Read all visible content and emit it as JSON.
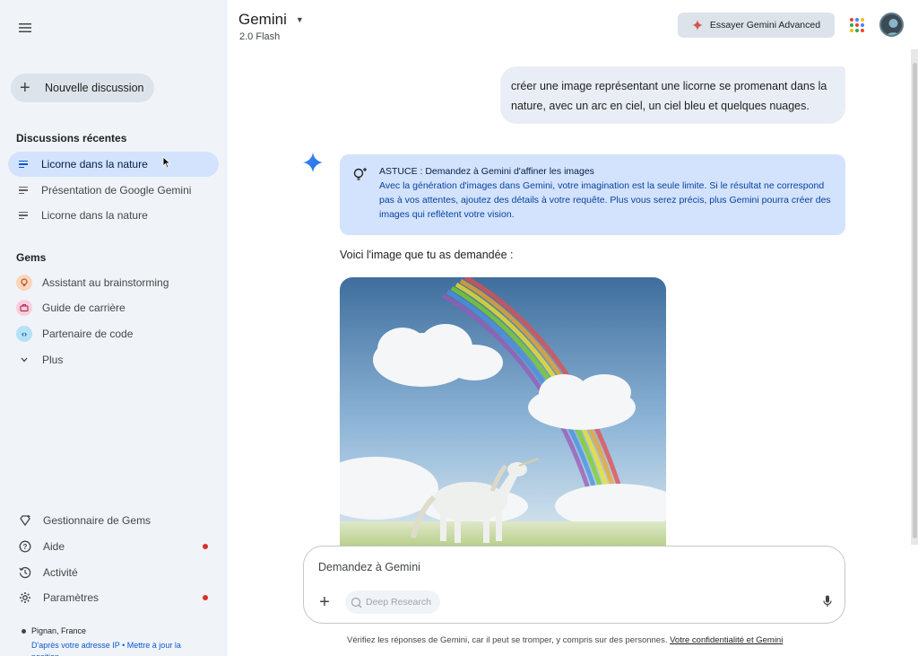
{
  "header": {
    "app_title": "Gemini",
    "model": "2.0 Flash",
    "advanced_button": "Essayer Gemini Advanced"
  },
  "sidebar": {
    "new_chat": "Nouvelle discussion",
    "recent_title": "Discussions récentes",
    "recent": [
      {
        "label": "Licorne dans la nature",
        "active": true
      },
      {
        "label": "Présentation de Google Gemini",
        "active": false
      },
      {
        "label": "Licorne dans la nature",
        "active": false
      }
    ],
    "gems_title": "Gems",
    "gems": [
      {
        "label": "Assistant au brainstorming",
        "icon": "lightbulb-icon",
        "color": "#f9c4a5"
      },
      {
        "label": "Guide de carrière",
        "icon": "briefcase-icon",
        "color": "#f5bfd0"
      },
      {
        "label": "Partenaire de code",
        "icon": "code-icon",
        "color": "#a8dcf5"
      },
      {
        "label": "Plus",
        "icon": "chevron-down-icon"
      }
    ],
    "bottom": [
      {
        "label": "Gestionnaire de Gems",
        "icon": "gem-manager-icon"
      },
      {
        "label": "Aide",
        "icon": "help-icon",
        "dot": true
      },
      {
        "label": "Activité",
        "icon": "history-icon"
      },
      {
        "label": "Paramètres",
        "icon": "settings-icon",
        "dot": true
      }
    ],
    "location": {
      "place": "Pignan, France",
      "source": "D'après votre adresse IP",
      "separator": "•",
      "update_link": "Mettre à jour la position"
    }
  },
  "chat": {
    "user_message": "créer une image représentant une licorne se promenant dans la nature, avec un arc en ciel, un ciel bleu et quelques nuages.",
    "tip_title": "ASTUCE : Demandez à Gemini d'affiner les images",
    "tip_text": "Avec la génération d'images dans Gemini, votre imagination est la seule limite. Si le résultat ne correspond pas à vos attentes, ajoutez des détails à votre requête. Plus vous serez précis, plus Gemini pourra créer des images qui reflètent votre vision.",
    "reply_text": "Voici l'image que tu as demandée :"
  },
  "input": {
    "placeholder": "Demandez à Gemini",
    "deep_research": "Deep Research"
  },
  "footer": {
    "disclaimer": "Vérifiez les réponses de Gemini, car il peut se tromper, y compris sur des personnes.",
    "privacy_link": "Votre confidentialité et Gemini"
  },
  "colors": {
    "sidebar_bg": "#f0f4f9",
    "active_item": "#d3e3fd",
    "tip_bg": "#d3e3fd",
    "accent": "#0b57d0",
    "notification_dot": "#d93025"
  }
}
